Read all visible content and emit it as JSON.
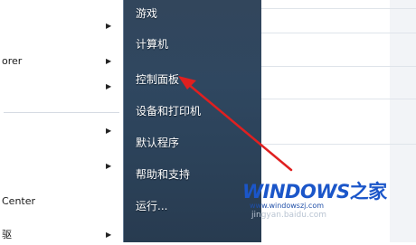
{
  "left_menu": {
    "items": [
      {
        "label": "",
        "has_arrow": true
      },
      {
        "label": "orer",
        "has_arrow": true
      },
      {
        "label": "",
        "has_arrow": true
      },
      {
        "label": "",
        "has_arrow": true
      },
      {
        "label": "",
        "has_arrow": true
      },
      {
        "label": "Center",
        "has_arrow": false
      },
      {
        "label": "驱",
        "has_arrow": true
      }
    ]
  },
  "right_menu": {
    "items": [
      {
        "label": "游戏"
      },
      {
        "label": "计算机"
      },
      {
        "label": "控制面板"
      },
      {
        "label": "设备和打印机"
      },
      {
        "label": "默认程序"
      },
      {
        "label": "帮助和支持"
      },
      {
        "label": "运行..."
      }
    ]
  },
  "annotation": {
    "arrow_color": "#e02020"
  },
  "watermark": {
    "logo_text": "WINDOWS",
    "logo_suffix": "之家",
    "url": "www.windowszj.com",
    "faint_text": "jingyan.baidu.com"
  },
  "colors": {
    "menu_bg": "#2f4760",
    "logo_blue": "#1b56c9"
  }
}
